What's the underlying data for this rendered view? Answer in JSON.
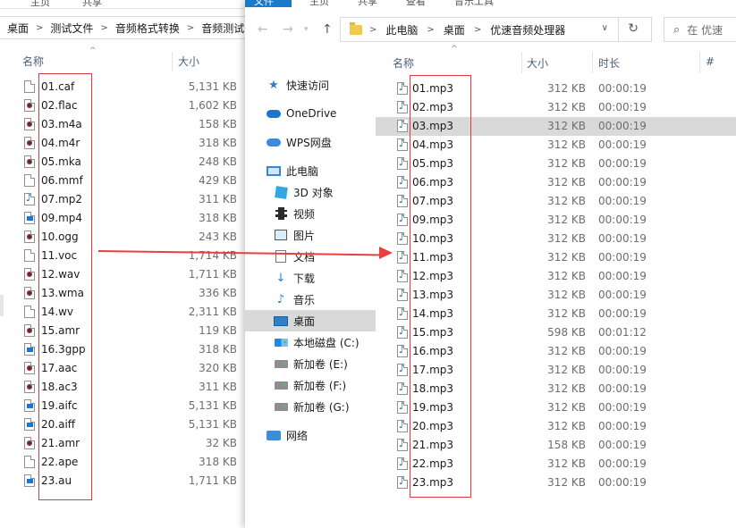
{
  "left_window": {
    "ribbon_tabs": [
      "主页",
      "共享"
    ],
    "breadcrumb": [
      "桌面",
      "测试文件",
      "音频格式转换",
      "音频测试"
    ],
    "columns": {
      "name": "名称",
      "size": "大小"
    },
    "files": [
      {
        "name": "01.caf",
        "size": "5,131 KB",
        "icon": "file-icon"
      },
      {
        "name": "02.flac",
        "size": "1,602 KB",
        "icon": "media-icon"
      },
      {
        "name": "03.m4a",
        "size": "158 KB",
        "icon": "media-icon"
      },
      {
        "name": "04.m4r",
        "size": "318 KB",
        "icon": "media-icon"
      },
      {
        "name": "05.mka",
        "size": "248 KB",
        "icon": "media-icon"
      },
      {
        "name": "06.mmf",
        "size": "429 KB",
        "icon": "file-icon"
      },
      {
        "name": "07.mp2",
        "size": "311 KB",
        "icon": "music-note-icon"
      },
      {
        "name": "09.mp4",
        "size": "318 KB",
        "icon": "video-icon"
      },
      {
        "name": "10.ogg",
        "size": "243 KB",
        "icon": "media-icon"
      },
      {
        "name": "11.voc",
        "size": "1,714 KB",
        "icon": "file-icon"
      },
      {
        "name": "12.wav",
        "size": "1,711 KB",
        "icon": "media-icon"
      },
      {
        "name": "13.wma",
        "size": "336 KB",
        "icon": "media-icon"
      },
      {
        "name": "14.wv",
        "size": "2,311 KB",
        "icon": "file-icon"
      },
      {
        "name": "15.amr",
        "size": "119 KB",
        "icon": "media-icon"
      },
      {
        "name": "16.3gpp",
        "size": "318 KB",
        "icon": "video-icon"
      },
      {
        "name": "17.aac",
        "size": "320 KB",
        "icon": "media-icon"
      },
      {
        "name": "18.ac3",
        "size": "311 KB",
        "icon": "media-icon"
      },
      {
        "name": "19.aifc",
        "size": "5,131 KB",
        "icon": "video-icon"
      },
      {
        "name": "20.aiff",
        "size": "5,131 KB",
        "icon": "video-icon"
      },
      {
        "name": "21.amr",
        "size": "32 KB",
        "icon": "media-icon"
      },
      {
        "name": "22.ape",
        "size": "318 KB",
        "icon": "file-icon"
      },
      {
        "name": "23.au",
        "size": "1,711 KB",
        "icon": "video-icon"
      }
    ]
  },
  "right_window": {
    "ribbon_tabs": [
      "文件",
      "主页",
      "共享",
      "查看",
      "音乐工具"
    ],
    "address": [
      "此电脑",
      "桌面",
      "优速音频处理器"
    ],
    "search_placeholder": "在 优速",
    "nav": [
      {
        "label": "快速访问",
        "icon": "star-icon"
      },
      {
        "label": "OneDrive",
        "icon": "onedrive-cloud-icon"
      },
      {
        "label": "WPS网盘",
        "icon": "wps-cloud-icon"
      },
      {
        "label": "此电脑",
        "icon": "computer-icon"
      },
      {
        "label": "3D 对象",
        "icon": "3d-objects-icon"
      },
      {
        "label": "视频",
        "icon": "video-folder-icon"
      },
      {
        "label": "图片",
        "icon": "pictures-icon"
      },
      {
        "label": "文档",
        "icon": "documents-icon"
      },
      {
        "label": "下载",
        "icon": "download-icon"
      },
      {
        "label": "音乐",
        "icon": "music-icon"
      },
      {
        "label": "桌面",
        "icon": "desktop-icon"
      },
      {
        "label": "本地磁盘 (C:)",
        "icon": "windows-drive-icon"
      },
      {
        "label": "新加卷 (E:)",
        "icon": "drive-icon"
      },
      {
        "label": "新加卷 (F:)",
        "icon": "drive-icon"
      },
      {
        "label": "新加卷 (G:)",
        "icon": "drive-icon"
      },
      {
        "label": "网络",
        "icon": "network-icon"
      }
    ],
    "columns": {
      "name": "名称",
      "size": "大小",
      "duration": "时长",
      "number": "#"
    },
    "files": [
      {
        "name": "01.mp3",
        "size": "312 KB",
        "duration": "00:00:19"
      },
      {
        "name": "02.mp3",
        "size": "312 KB",
        "duration": "00:00:19"
      },
      {
        "name": "03.mp3",
        "size": "312 KB",
        "duration": "00:00:19"
      },
      {
        "name": "04.mp3",
        "size": "312 KB",
        "duration": "00:00:19"
      },
      {
        "name": "05.mp3",
        "size": "312 KB",
        "duration": "00:00:19"
      },
      {
        "name": "06.mp3",
        "size": "312 KB",
        "duration": "00:00:19"
      },
      {
        "name": "07.mp3",
        "size": "312 KB",
        "duration": "00:00:19"
      },
      {
        "name": "09.mp3",
        "size": "312 KB",
        "duration": "00:00:19"
      },
      {
        "name": "10.mp3",
        "size": "312 KB",
        "duration": "00:00:19"
      },
      {
        "name": "11.mp3",
        "size": "312 KB",
        "duration": "00:00:19"
      },
      {
        "name": "12.mp3",
        "size": "312 KB",
        "duration": "00:00:19"
      },
      {
        "name": "13.mp3",
        "size": "312 KB",
        "duration": "00:00:19"
      },
      {
        "name": "14.mp3",
        "size": "312 KB",
        "duration": "00:00:19"
      },
      {
        "name": "15.mp3",
        "size": "598 KB",
        "duration": "00:01:12"
      },
      {
        "name": "16.mp3",
        "size": "312 KB",
        "duration": "00:00:19"
      },
      {
        "name": "17.mp3",
        "size": "312 KB",
        "duration": "00:00:19"
      },
      {
        "name": "18.mp3",
        "size": "312 KB",
        "duration": "00:00:19"
      },
      {
        "name": "19.mp3",
        "size": "312 KB",
        "duration": "00:00:19"
      },
      {
        "name": "20.mp3",
        "size": "312 KB",
        "duration": "00:00:19"
      },
      {
        "name": "21.mp3",
        "size": "158 KB",
        "duration": "00:00:19"
      },
      {
        "name": "22.mp3",
        "size": "312 KB",
        "duration": "00:00:19"
      },
      {
        "name": "23.mp3",
        "size": "312 KB",
        "duration": "00:00:19"
      }
    ],
    "selected_file": "03.mp3",
    "selected_nav": "桌面"
  },
  "colors": {
    "annotation_red": "#e0393b",
    "selection": "#d9d9d9",
    "accent_blue": "#1979ca"
  }
}
